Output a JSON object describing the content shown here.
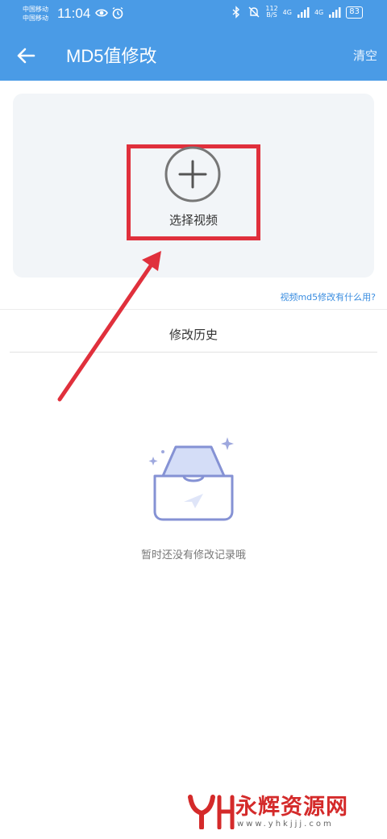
{
  "status_bar": {
    "carrier_1": "中国移动",
    "carrier_2": "中国移动",
    "time": "11:04",
    "net_speed_value": "112",
    "net_speed_unit": "B/S",
    "signal_1": "4G",
    "signal_2": "4G",
    "battery": "83"
  },
  "app_bar": {
    "title": "MD5值修改",
    "clear_label": "清空"
  },
  "upload": {
    "select_label": "选择视频"
  },
  "help_link": "视频md5修改有什么用?",
  "history": {
    "title": "修改历史",
    "empty_text": "暂时还没有修改记录哦"
  },
  "watermark": {
    "brand": "永辉资源网",
    "url": "www.yhkjjj.com"
  },
  "colors": {
    "app_bar": "#4a9be6",
    "highlight_box": "#e0303c",
    "link": "#3a8de0"
  }
}
